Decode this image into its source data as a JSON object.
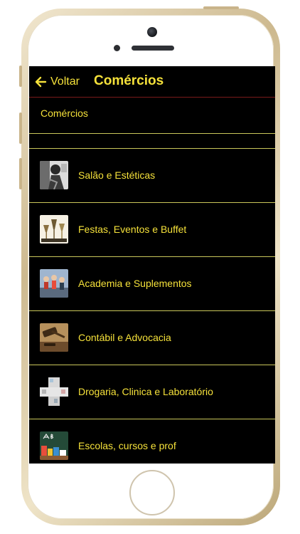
{
  "header": {
    "back_label": "Voltar",
    "title": "Comércios"
  },
  "section": {
    "title": "Comércios"
  },
  "categories": [
    {
      "label": "Salão e Estéticas",
      "icon": "salon-photo-icon"
    },
    {
      "label": "Festas, Eventos e Buffet",
      "icon": "party-glasses-icon"
    },
    {
      "label": "Academia e Suplementos",
      "icon": "gym-class-icon"
    },
    {
      "label": "Contábil e Advocacia",
      "icon": "gavel-icon"
    },
    {
      "label": "Drogaria, Clinica e Laboratório",
      "icon": "pharmacy-icon"
    },
    {
      "label": "Escolas, cursos e prof",
      "icon": "chalkboard-icon"
    }
  ],
  "colors": {
    "text_accent": "#f5e13a",
    "screen_background": "#000000",
    "divider": "#c9c65a",
    "header_rule": "#7a1b1b"
  }
}
